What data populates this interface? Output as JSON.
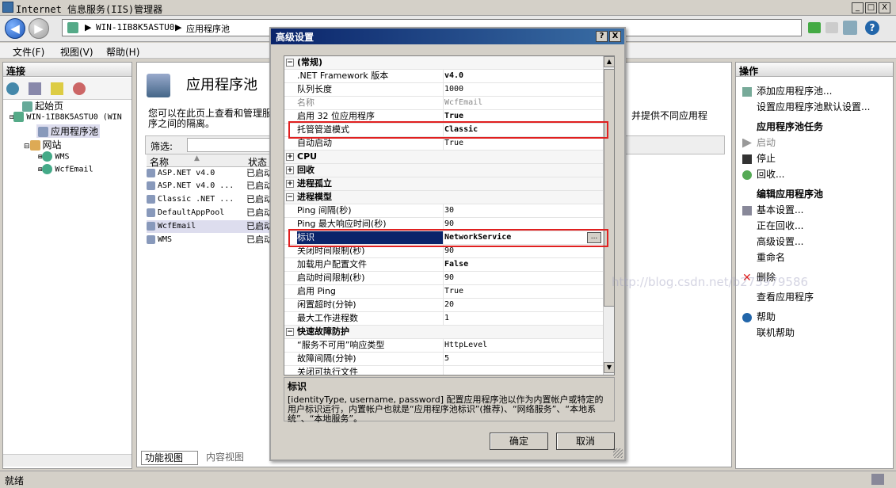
{
  "window": {
    "title": "Internet 信息服务(IIS)管理器",
    "min": "_",
    "max": "□",
    "close": "X"
  },
  "address": {
    "server": "WIN-1IB8K5ASTU0",
    "page": "应用程序池",
    "sep": "▶"
  },
  "menu": [
    "文件(F)",
    "视图(V)",
    "帮助(H)"
  ],
  "left": {
    "header": "连接",
    "tree": [
      {
        "label": "起始页"
      },
      {
        "label": "WIN-1IB8K5ASTU0 (WIN"
      },
      {
        "label": "应用程序池"
      },
      {
        "label": "网站"
      },
      {
        "label": "WMS"
      },
      {
        "label": "WcfEmail"
      }
    ]
  },
  "center": {
    "title": "应用程序池",
    "desc_a": "您可以在此页上查看和管理服",
    "desc_b": "序之间的隔离。",
    "desc_right": "，并提供不同应用程",
    "filter_label": "筛选:",
    "col_name": "名称",
    "col_status": "状态",
    "pools": [
      {
        "name": "ASP.NET v4.0",
        "status": "已启动"
      },
      {
        "name": "ASP.NET v4.0 ...",
        "status": "已启动"
      },
      {
        "name": "Classic .NET ...",
        "status": "已启动"
      },
      {
        "name": "DefaultAppPool",
        "status": "已启动"
      },
      {
        "name": "WcfEmail",
        "status": "已启动"
      },
      {
        "name": "WMS",
        "status": "已启动"
      }
    ],
    "tab_feature": "功能视图",
    "tab_content": "内容视图"
  },
  "right": {
    "header": "操作",
    "items": [
      {
        "label": "添加应用程序池..."
      },
      {
        "label": "设置应用程序池默认设置..."
      },
      {
        "label": "应用程序池任务"
      },
      {
        "label": "启动"
      },
      {
        "label": "停止"
      },
      {
        "label": "回收..."
      },
      {
        "label": "编辑应用程序池"
      },
      {
        "label": "基本设置..."
      },
      {
        "label": "正在回收..."
      },
      {
        "label": "高级设置..."
      },
      {
        "label": "重命名"
      },
      {
        "label": "删除"
      },
      {
        "label": "查看应用程序"
      },
      {
        "label": "帮助"
      },
      {
        "label": "联机帮助"
      }
    ]
  },
  "status": {
    "text": "就绪"
  },
  "dialog": {
    "title": "高级设置",
    "help": "?",
    "close": "X",
    "rows": [
      {
        "name": "(常规)",
        "value": ""
      },
      {
        "name": ".NET Framework 版本",
        "value": "v4.0"
      },
      {
        "name": "队列长度",
        "value": "1000"
      },
      {
        "name": "名称",
        "value": "WcfEmail"
      },
      {
        "name": "启用 32 位应用程序",
        "value": "True"
      },
      {
        "name": "托管管道模式",
        "value": "Classic"
      },
      {
        "name": "自动启动",
        "value": "True"
      },
      {
        "name": "CPU",
        "value": ""
      },
      {
        "name": "回收",
        "value": ""
      },
      {
        "name": "进程孤立",
        "value": ""
      },
      {
        "name": "进程模型",
        "value": ""
      },
      {
        "name": "Ping 间隔(秒)",
        "value": "30"
      },
      {
        "name": "Ping 最大响应时间(秒)",
        "value": "90"
      },
      {
        "name": "标识",
        "value": "NetworkService"
      },
      {
        "name": "关闭时间限制(秒)",
        "value": "90"
      },
      {
        "name": "加载用户配置文件",
        "value": "False"
      },
      {
        "name": "启动时间限制(秒)",
        "value": "90"
      },
      {
        "name": "启用 Ping",
        "value": "True"
      },
      {
        "name": "闲置超时(分钟)",
        "value": "20"
      },
      {
        "name": "最大工作进程数",
        "value": "1"
      },
      {
        "name": "快速故障防护",
        "value": ""
      },
      {
        "name": "“服务不可用”响应类型",
        "value": "HttpLevel"
      },
      {
        "name": "故障间隔(分钟)",
        "value": "5"
      },
      {
        "name": "关闭可执行文件",
        "value": ""
      }
    ],
    "ellipsis": "...",
    "desc_title": "标识",
    "desc_body": "[identityType, username, password] 配置应用程序池以作为内置帐户或特定的用户标识运行，内置帐户也就是“应用程序池标识”(推荐)、“网络服务”、“本地系统”、“本地服务”。",
    "ok": "确定",
    "cancel": "取消"
  },
  "watermark": "http://blog.csdn.net/b273979586",
  "colors": {
    "highlight": "#e02020",
    "selection": "#0a246a"
  }
}
